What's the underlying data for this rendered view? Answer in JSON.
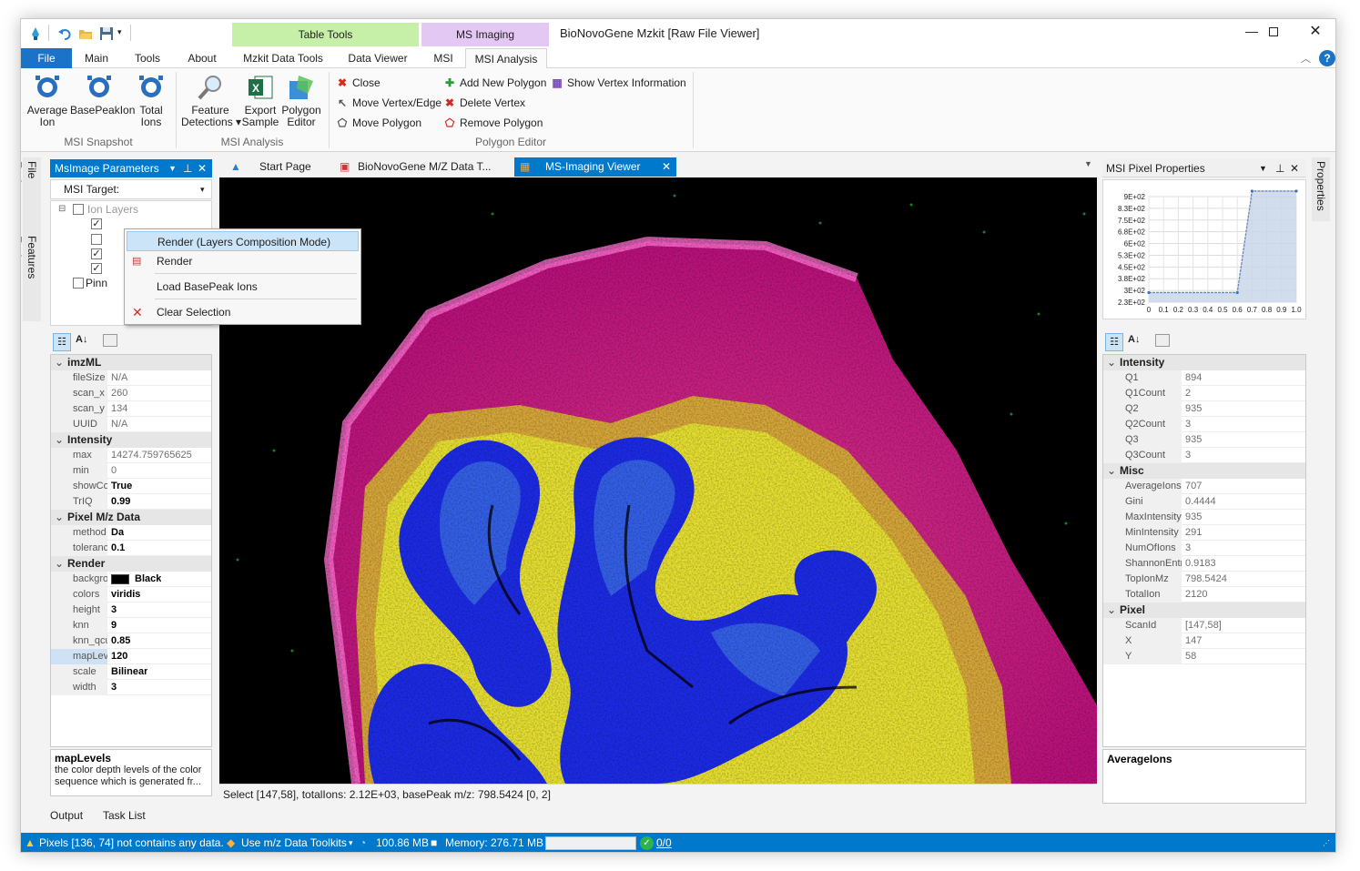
{
  "window": {
    "title": "BioNovoGene Mzkit [Raw File Viewer]"
  },
  "quick_access": {
    "icons": [
      "app-icon",
      "undo-icon",
      "open-folder-icon",
      "save-icon",
      "customize-icon"
    ]
  },
  "context_groups": {
    "table_tools": "Table Tools",
    "ms_imaging": "MS Imaging"
  },
  "ribbon_tabs": [
    "File",
    "Main",
    "Tools",
    "About",
    "Mzkit Data Tools",
    "Data Viewer",
    "MSI",
    "MSI Analysis"
  ],
  "ribbon": {
    "msi_snapshot": {
      "label": "MSI Snapshot",
      "buttons": [
        {
          "label": "Average\nIon"
        },
        {
          "label": "BasePeakIon"
        },
        {
          "label": "Total\nIons"
        }
      ]
    },
    "msi_analysis": {
      "label": "MSI Analysis",
      "buttons": [
        {
          "label": "Feature\nDetections ▾"
        },
        {
          "label": "Export\nSample"
        },
        {
          "label": "Polygon\nEditor"
        }
      ]
    },
    "polygon_editor": {
      "label": "Polygon Editor",
      "close": "Close",
      "move_vertex": "Move Vertex/Edge",
      "move_polygon": "Move Polygon",
      "add_polygon": "Add New Polygon",
      "delete_vertex": "Delete Vertex",
      "remove_polygon": "Remove Polygon",
      "show_vertex": "Show Vertex Information"
    }
  },
  "side_tabs_left": [
    "File Explorer",
    "Features Explorer"
  ],
  "side_tabs_right": [
    "Properties"
  ],
  "left_panel": {
    "title": "MsImage Parameters",
    "msi_target": "MSI Target:",
    "tree_root": "Ion Layers",
    "tree_pinned": "Pinn",
    "description_title": "mapLevels",
    "description_text": "the color depth levels of the color sequence which is generated fr...",
    "grid": [
      {
        "cat": "imzML",
        "rows": [
          [
            "fileSize",
            "N/A"
          ],
          [
            "scan_x",
            "260"
          ],
          [
            "scan_y",
            "134"
          ],
          [
            "UUID",
            "N/A"
          ]
        ]
      },
      {
        "cat": "Intensity",
        "rows": [
          [
            "max",
            "14274.759765625"
          ],
          [
            "min",
            "0"
          ],
          [
            "showColorMap",
            "True"
          ],
          [
            "TrIQ",
            "0.99"
          ]
        ]
      },
      {
        "cat": "Pixel M/z Data",
        "rows": [
          [
            "method",
            "Da"
          ],
          [
            "tolerance",
            "0.1"
          ]
        ]
      },
      {
        "cat": "Render",
        "rows": [
          [
            "background",
            "Black"
          ],
          [
            "colors",
            "viridis"
          ],
          [
            "height",
            "3"
          ],
          [
            "knn",
            "9"
          ],
          [
            "knn_qcut",
            "0.85"
          ],
          [
            "mapLevels",
            "120"
          ],
          [
            "scale",
            "Bilinear"
          ],
          [
            "width",
            "3"
          ]
        ]
      }
    ]
  },
  "context_menu": [
    {
      "label": "Render (Layers Composition Mode)",
      "icon": ""
    },
    {
      "label": "Render",
      "icon": "render-icon"
    },
    {
      "label": "Load BasePeak Ions",
      "icon": ""
    },
    {
      "label": "Clear Selection",
      "icon": "clear-icon"
    }
  ],
  "doc_tabs": [
    {
      "label": "Start Page"
    },
    {
      "label": "BioNovoGene M/Z Data T..."
    },
    {
      "label": "MS-Imaging Viewer"
    }
  ],
  "viewer": {
    "status": "Select [147,58], totalIons: 2.12E+03, basePeak m/z: 798.5424  [0, 2]"
  },
  "right_panel": {
    "title": "MSI Pixel Properties",
    "description_title": "AverageIons",
    "grid": [
      {
        "cat": "Intensity",
        "rows": [
          [
            "Q1",
            "894"
          ],
          [
            "Q1Count",
            "2"
          ],
          [
            "Q2",
            "935"
          ],
          [
            "Q2Count",
            "3"
          ],
          [
            "Q3",
            "935"
          ],
          [
            "Q3Count",
            "3"
          ]
        ]
      },
      {
        "cat": "Misc",
        "rows": [
          [
            "AverageIons",
            "707"
          ],
          [
            "Gini",
            "0.4444"
          ],
          [
            "MaxIntensity",
            "935"
          ],
          [
            "MinIntensity",
            "291"
          ],
          [
            "NumOfIons",
            "3"
          ],
          [
            "ShannonEntropy",
            "0.9183"
          ],
          [
            "TopIonMz",
            "798.5424"
          ],
          [
            "TotalIon",
            "2120"
          ]
        ]
      },
      {
        "cat": "Pixel",
        "rows": [
          [
            "ScanId",
            "[147,58]"
          ],
          [
            "X",
            "147"
          ],
          [
            "Y",
            "58"
          ]
        ]
      }
    ]
  },
  "chart_data": {
    "type": "area",
    "x": [
      0,
      0.6,
      0.7,
      1.0
    ],
    "values": [
      291,
      291,
      935,
      935
    ],
    "xticks": [
      "0",
      "0.1",
      "0.2",
      "0.3",
      "0.4",
      "0.5",
      "0.6",
      "0.7",
      "0.8",
      "0.9",
      "1.0"
    ],
    "yticks": [
      "9E+02",
      "8.3E+02",
      "7.5E+02",
      "6.8E+02",
      "6E+02",
      "5.3E+02",
      "4.5E+02",
      "3.8E+02",
      "3E+02",
      "2.3E+02"
    ],
    "ylim": [
      230,
      900
    ],
    "xlim": [
      0,
      1
    ]
  },
  "bottom_tabs": [
    "Output",
    "Task List"
  ],
  "statusbar": {
    "warning": "Pixels [136, 74] not contains any data.",
    "toolkit": "Use m/z Data Toolkits",
    "memory1": "100.86 MB",
    "memory2": "Memory: 276.71 MB",
    "tasks": "0/0"
  },
  "colors": {
    "accent": "#0079cc",
    "table_tools": "#c6efa8",
    "ms_imaging": "#e4c8f4"
  }
}
